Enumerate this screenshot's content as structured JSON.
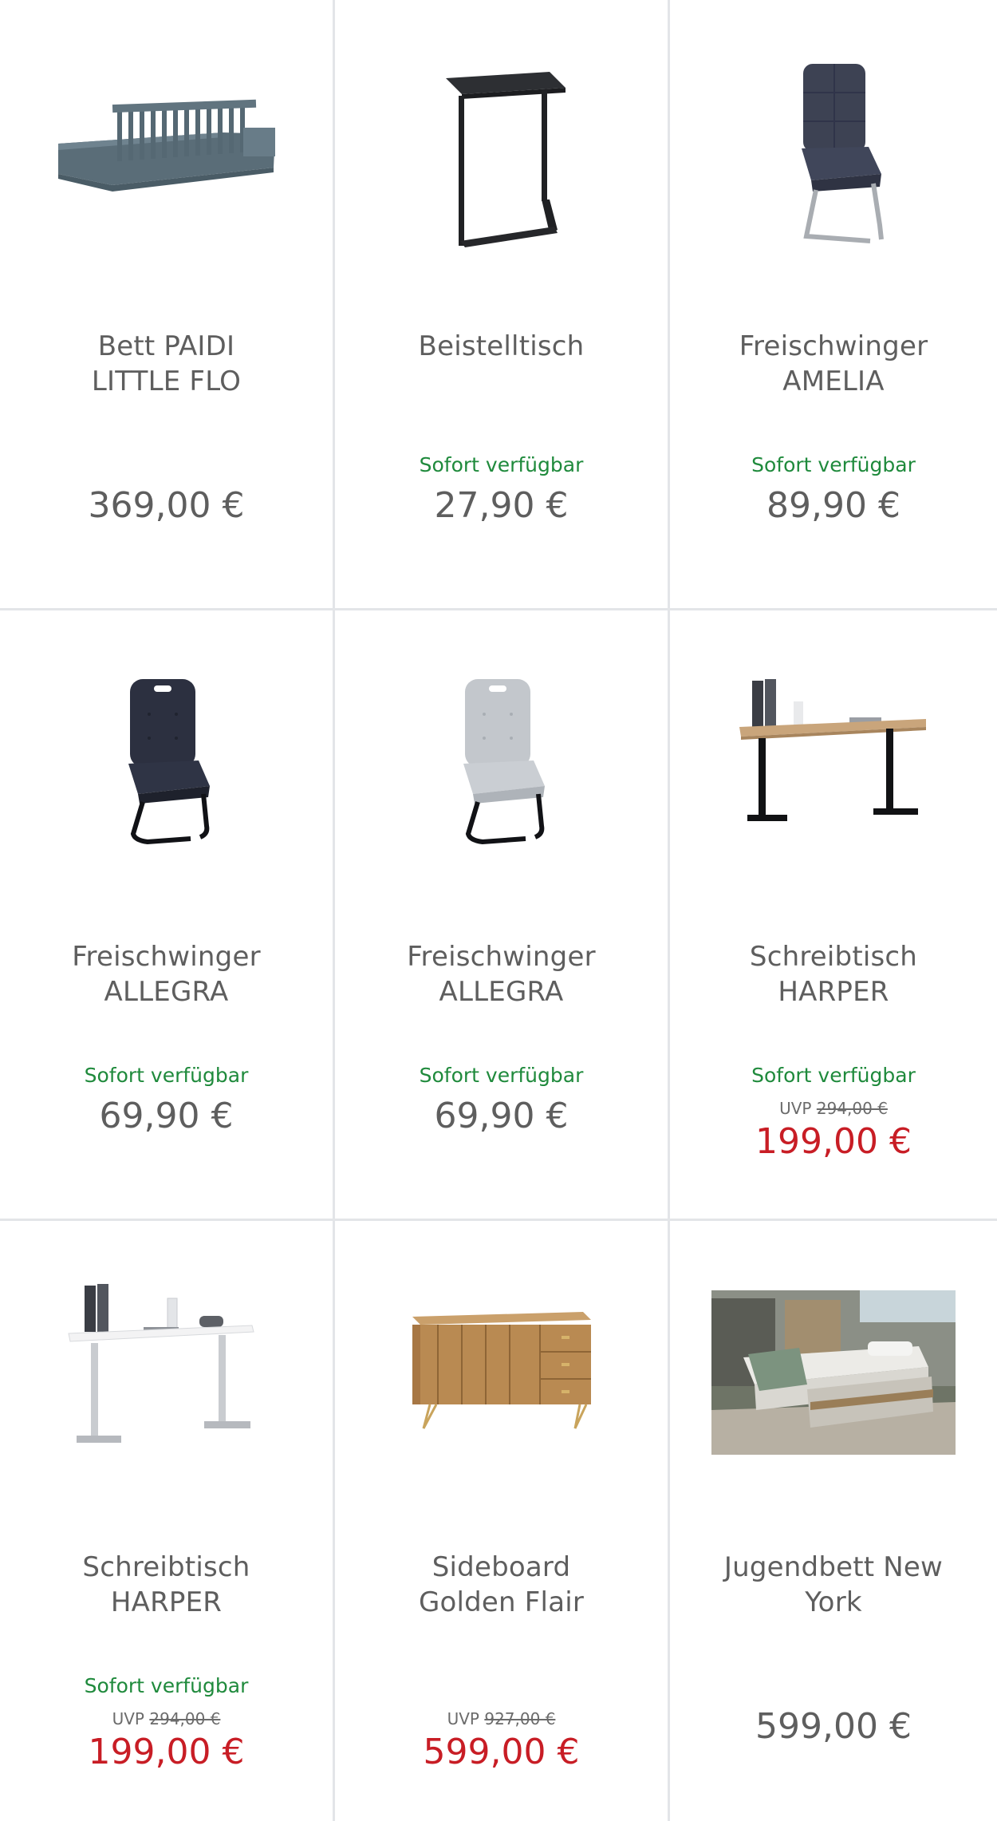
{
  "products": [
    {
      "title_line1": "Bett PAIDI",
      "title_line2": "LITTLE FLO",
      "availability": "",
      "uvp_label": "",
      "uvp_price": "",
      "price": "369,00 €",
      "sale": false,
      "image": "paidi-bed-image"
    },
    {
      "title_line1": "Beistelltisch",
      "title_line2": "",
      "availability": "Sofort verfügbar",
      "uvp_label": "",
      "uvp_price": "",
      "price": "27,90 €",
      "sale": false,
      "image": "side-table-image"
    },
    {
      "title_line1": "Freischwinger",
      "title_line2": "AMELIA",
      "availability": "Sofort verfügbar",
      "uvp_label": "",
      "uvp_price": "",
      "price": "89,90 €",
      "sale": false,
      "image": "amelia-chair-image"
    },
    {
      "title_line1": "Freischwinger",
      "title_line2": "ALLEGRA",
      "availability": "Sofort verfügbar",
      "uvp_label": "",
      "uvp_price": "",
      "price": "69,90 €",
      "sale": false,
      "image": "allegra-dark-chair-image"
    },
    {
      "title_line1": "Freischwinger",
      "title_line2": "ALLEGRA",
      "availability": "Sofort verfügbar",
      "uvp_label": "",
      "uvp_price": "",
      "price": "69,90 €",
      "sale": false,
      "image": "allegra-light-chair-image"
    },
    {
      "title_line1": "Schreibtisch",
      "title_line2": "HARPER",
      "availability": "Sofort verfügbar",
      "uvp_label": "UVP",
      "uvp_price": "294,00 €",
      "price": "199,00 €",
      "sale": true,
      "image": "harper-desk-oak-image"
    },
    {
      "title_line1": "Schreibtisch",
      "title_line2": "HARPER",
      "availability": "Sofort verfügbar",
      "uvp_label": "UVP",
      "uvp_price": "294,00 €",
      "price": "199,00 €",
      "sale": true,
      "image": "harper-desk-white-image"
    },
    {
      "title_line1": "Sideboard",
      "title_line2": "Golden Flair",
      "availability": "",
      "uvp_label": "UVP",
      "uvp_price": "927,00 €",
      "price": "599,00 €",
      "sale": true,
      "image": "sideboard-image"
    },
    {
      "title_line1": "Jugendbett New",
      "title_line2": "York",
      "availability": "",
      "uvp_label": "",
      "uvp_price": "",
      "price": "599,00 €",
      "sale": false,
      "image": "youth-bed-photo"
    }
  ],
  "colors": {
    "available": "#1f8a3c",
    "sale_price": "#c81d25",
    "price": "#5e5e5e",
    "divider": "#e3e5e8"
  }
}
